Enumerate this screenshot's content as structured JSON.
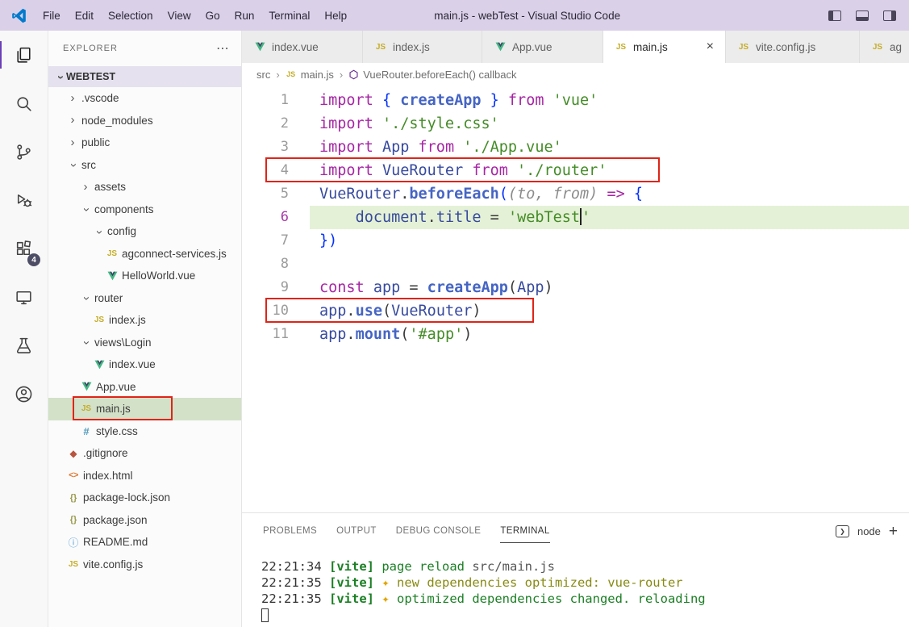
{
  "colors": {
    "annotation_red": "#E02418",
    "accent_purple": "#6C3FB8",
    "titlebar_lavender": "#DAD1E9",
    "vue_green": "#41B883",
    "js_yellow": "#C5AD28",
    "keyword_purple": "#A626A4",
    "function_blue": "#4565C4",
    "string_green": "#448C27",
    "current_line_green": "#E4F1D6",
    "selection_green": "#D3E1C8",
    "terminal_green": "#1B7F24"
  },
  "title_bar": {
    "menus": [
      "File",
      "Edit",
      "Selection",
      "View",
      "Go",
      "Run",
      "Terminal",
      "Help"
    ],
    "title": "main.js - webTest - Visual Studio Code"
  },
  "activity_bar": {
    "icons": [
      "explorer-icon",
      "search-icon",
      "source-control-icon",
      "run-debug-icon",
      "extensions-icon",
      "remote-explorer-icon",
      "testing-icon",
      "account-icon"
    ],
    "extensions_badge": "4"
  },
  "icons": {
    "js": "JS",
    "css": "#",
    "html": "<>",
    "json": "{}",
    "info": "ⓘ",
    "git": "◆",
    "chevron": "›",
    "more": "⋯",
    "prompt": "❯"
  },
  "sidebar": {
    "header": "EXPLORER",
    "root_label": "WEBTEST",
    "tree": [
      {
        "label": ".vscode",
        "depth": 1,
        "chevron": "right",
        "icon": "none"
      },
      {
        "label": "node_modules",
        "depth": 1,
        "chevron": "right",
        "icon": "none"
      },
      {
        "label": "public",
        "depth": 1,
        "chevron": "right",
        "icon": "none"
      },
      {
        "label": "src",
        "depth": 1,
        "chevron": "down",
        "icon": "none"
      },
      {
        "label": "assets",
        "depth": 2,
        "chevron": "right",
        "icon": "none"
      },
      {
        "label": "components",
        "depth": 2,
        "chevron": "down",
        "icon": "none"
      },
      {
        "label": "config",
        "depth": 3,
        "chevron": "down",
        "icon": "none"
      },
      {
        "label": "agconnect-services.js",
        "depth": 4,
        "chevron": "none",
        "icon": "js"
      },
      {
        "label": "HelloWorld.vue",
        "depth": 4,
        "chevron": "none",
        "icon": "vue"
      },
      {
        "label": "router",
        "depth": 2,
        "chevron": "down",
        "icon": "none"
      },
      {
        "label": "index.js",
        "depth": 3,
        "chevron": "none",
        "icon": "js"
      },
      {
        "label": "views\\Login",
        "depth": 2,
        "chevron": "down",
        "icon": "none"
      },
      {
        "label": "index.vue",
        "depth": 3,
        "chevron": "none",
        "icon": "vue"
      },
      {
        "label": "App.vue",
        "depth": 2,
        "chevron": "none",
        "icon": "vue"
      },
      {
        "label": "main.js",
        "depth": 2,
        "chevron": "none",
        "icon": "js",
        "selected": true,
        "annotated": true
      },
      {
        "label": "style.css",
        "depth": 2,
        "chevron": "none",
        "icon": "css"
      },
      {
        "label": ".gitignore",
        "depth": 1,
        "chevron": "none",
        "icon": "git"
      },
      {
        "label": "index.html",
        "depth": 1,
        "chevron": "none",
        "icon": "html"
      },
      {
        "label": "package-lock.json",
        "depth": 1,
        "chevron": "none",
        "icon": "json"
      },
      {
        "label": "package.json",
        "depth": 1,
        "chevron": "none",
        "icon": "json"
      },
      {
        "label": "README.md",
        "depth": 1,
        "chevron": "none",
        "icon": "info"
      },
      {
        "label": "vite.config.js",
        "depth": 1,
        "chevron": "none",
        "icon": "js"
      }
    ]
  },
  "tabs": [
    {
      "label": "index.vue",
      "icon": "vue",
      "active": false
    },
    {
      "label": "index.js",
      "icon": "js",
      "active": false
    },
    {
      "label": "App.vue",
      "icon": "vue",
      "active": false
    },
    {
      "label": "main.js",
      "icon": "js",
      "active": true,
      "close": "×"
    },
    {
      "label": "vite.config.js",
      "icon": "js",
      "active": false
    },
    {
      "label": "ag",
      "icon": "js",
      "active": false
    }
  ],
  "breadcrumb": {
    "separator": "›",
    "items": [
      {
        "label": "src"
      },
      {
        "label": "main.js",
        "icon": "js"
      },
      {
        "label": "VueRouter.beforeEach() callback",
        "icon": "symbol"
      }
    ]
  },
  "editor": {
    "lines": [
      {
        "n": "1",
        "tokens": [
          [
            "kw",
            "import "
          ],
          [
            "brk",
            "{ "
          ],
          [
            "fn",
            "createApp"
          ],
          [
            "brk",
            " }"
          ],
          [
            "kw",
            " from "
          ],
          [
            "str",
            "'vue'"
          ]
        ]
      },
      {
        "n": "2",
        "tokens": [
          [
            "kw",
            "import "
          ],
          [
            "str",
            "'./style.css'"
          ]
        ]
      },
      {
        "n": "3",
        "tokens": [
          [
            "kw",
            "import "
          ],
          [
            "var",
            "App"
          ],
          [
            "kw",
            " from "
          ],
          [
            "str",
            "'./App.vue'"
          ]
        ]
      },
      {
        "n": "4",
        "tokens": [
          [
            "kw",
            "import "
          ],
          [
            "var",
            "VueRouter"
          ],
          [
            "kw",
            " from "
          ],
          [
            "str",
            "'./router'"
          ]
        ]
      },
      {
        "n": "5",
        "tokens": [
          [
            "var",
            "VueRouter"
          ],
          [
            "pun",
            "."
          ],
          [
            "fn",
            "beforeEach"
          ],
          [
            "brk",
            "("
          ],
          [
            "param",
            "(to, from)"
          ],
          [
            "pun",
            " "
          ],
          [
            "kw",
            "=>"
          ],
          [
            "pun",
            " "
          ],
          [
            "brk",
            "{"
          ]
        ]
      },
      {
        "n": "6",
        "current": true,
        "tokens": [
          [
            "pun",
            "    "
          ],
          [
            "var",
            "document"
          ],
          [
            "pun",
            "."
          ],
          [
            "var",
            "title"
          ],
          [
            "pun",
            " = "
          ],
          [
            "str",
            "'webTest"
          ],
          [
            "cursor",
            ""
          ],
          [
            "str",
            "'"
          ]
        ]
      },
      {
        "n": "7",
        "tokens": [
          [
            "brk",
            "})"
          ]
        ]
      },
      {
        "n": "8",
        "tokens": []
      },
      {
        "n": "9",
        "tokens": [
          [
            "kw",
            "const "
          ],
          [
            "var",
            "app"
          ],
          [
            "pun",
            " = "
          ],
          [
            "fn",
            "createApp"
          ],
          [
            "pun",
            "("
          ],
          [
            "var",
            "App"
          ],
          [
            "pun",
            ")"
          ]
        ]
      },
      {
        "n": "10",
        "tokens": [
          [
            "var",
            "app"
          ],
          [
            "pun",
            "."
          ],
          [
            "fn",
            "use"
          ],
          [
            "pun",
            "("
          ],
          [
            "var",
            "VueRouter"
          ],
          [
            "pun",
            ")"
          ]
        ]
      },
      {
        "n": "11",
        "tokens": [
          [
            "var",
            "app"
          ],
          [
            "pun",
            "."
          ],
          [
            "fn",
            "mount"
          ],
          [
            "pun",
            "("
          ],
          [
            "str",
            "'#app'"
          ],
          [
            "pun",
            ")"
          ]
        ]
      }
    ]
  },
  "panel": {
    "tabs": [
      {
        "label": "PROBLEMS",
        "active": false
      },
      {
        "label": "OUTPUT",
        "active": false
      },
      {
        "label": "DEBUG CONSOLE",
        "active": false
      },
      {
        "label": "TERMINAL",
        "active": true
      }
    ],
    "shell_label": "node",
    "new_terminal": "+"
  },
  "terminal": {
    "lines": [
      [
        [
          "time",
          "22:21:34 "
        ],
        [
          "vite",
          "[vite]"
        ],
        [
          "ok",
          " page reload "
        ],
        [
          "dim",
          "src/main.js"
        ]
      ],
      [
        [
          "time",
          "22:21:35 "
        ],
        [
          "vite",
          "[vite] "
        ],
        [
          "star",
          "✦"
        ],
        [
          "olive",
          " new dependencies optimized: vue-router"
        ]
      ],
      [
        [
          "time",
          "22:21:35 "
        ],
        [
          "vite",
          "[vite] "
        ],
        [
          "star",
          "✦"
        ],
        [
          "ok",
          " optimized dependencies changed. reloading"
        ]
      ]
    ]
  }
}
